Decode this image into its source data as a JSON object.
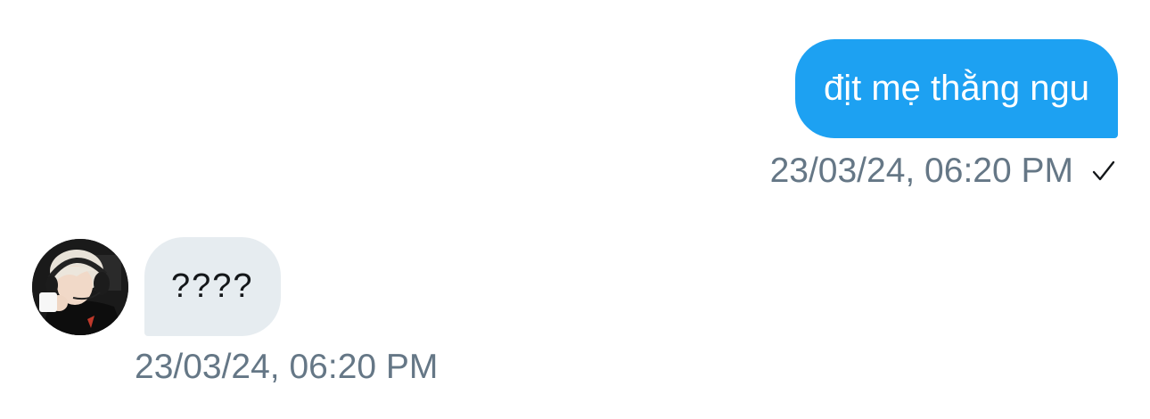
{
  "outgoing": {
    "text": "địt mẹ thằng ngu",
    "timestamp": "23/03/24, 06:20 PM",
    "status_icon": "check-icon",
    "bubble_color": "#1da1f2"
  },
  "incoming": {
    "text": "????",
    "timestamp": "23/03/24, 06:20 PM",
    "avatar_icon": "avatar",
    "bubble_color": "#e6ecf0"
  },
  "colors": {
    "timestamp": "#657786",
    "background": "#ffffff"
  }
}
